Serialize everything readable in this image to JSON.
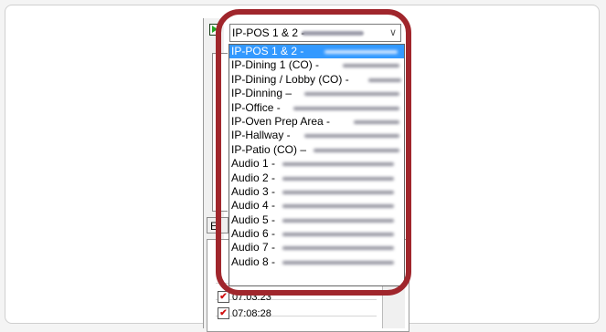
{
  "combo": {
    "selected": "IP-POS 1 & 2 -",
    "chevron_icon": "chevron-down-icon"
  },
  "dropdown": {
    "items": [
      {
        "label": "IP-POS 1 & 2 -",
        "selected": true
      },
      {
        "label": "IP-Dining 1 (CO) -"
      },
      {
        "label": "IP-Dining / Lobby (CO) -"
      },
      {
        "label": "IP-Dinning –"
      },
      {
        "label": "IP-Office -"
      },
      {
        "label": "IP-Oven Prep Area -"
      },
      {
        "label": "IP-Hallway -"
      },
      {
        "label": "IP-Patio (CO) –"
      },
      {
        "label": "Audio 1 -"
      },
      {
        "label": "Audio 2 -"
      },
      {
        "label": "Audio 3 -"
      },
      {
        "label": "Audio 4 -"
      },
      {
        "label": "Audio 5 -"
      },
      {
        "label": "Audio 6 -"
      },
      {
        "label": "Audio 7 -"
      },
      {
        "label": "Audio 8 -"
      }
    ]
  },
  "background": {
    "tab_label": "E",
    "rows": [
      {
        "time": "07:03:23",
        "checked": true
      },
      {
        "time": "07:08:28",
        "checked": true
      }
    ]
  },
  "highlight_color": "#a0262c",
  "selection_color": "#3399ff"
}
